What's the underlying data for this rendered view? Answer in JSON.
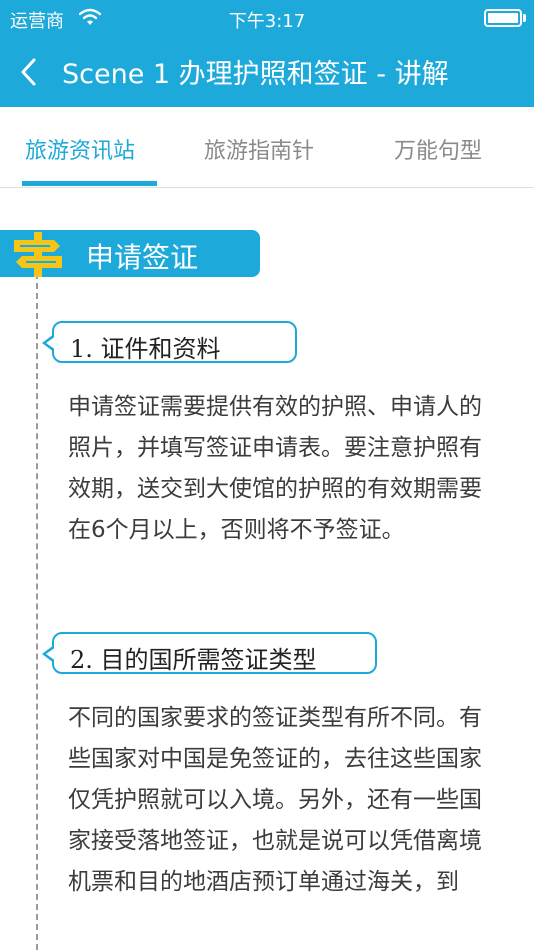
{
  "status_bar": {
    "carrier": "运营商",
    "time": "下午3:17"
  },
  "nav": {
    "title": "Scene 1 办理护照和签证 - 讲解"
  },
  "tabs": [
    {
      "label": "旅游资讯站"
    },
    {
      "label": "旅游指南针"
    },
    {
      "label": "万能句型"
    }
  ],
  "section": {
    "title": "申请签证"
  },
  "items": [
    {
      "heading": "1. 证件和资料",
      "body": "申请签证需要提供有效的护照、申请人的照片，并填写签证申请表。要注意护照有效期，送交到大使馆的护照的有效期需要在6个月以上，否则将不予签证。"
    },
    {
      "heading": "2. 目的国所需签证类型",
      "body": "不同的国家要求的签证类型有所不同。有些国家对中国是免签证的，去往这些国家仅凭护照就可以入境。另外，还有一些国家接受落地签证，也就是说可以凭借离境机票和目的地酒店预订单通过海关，到"
    }
  ],
  "colors": {
    "accent": "#1da9d9",
    "signpost": "#f5c518"
  },
  "icons": {
    "back": "chevron-left-icon",
    "wifi": "wifi-icon",
    "battery": "battery-icon",
    "section": "signpost-icon"
  }
}
